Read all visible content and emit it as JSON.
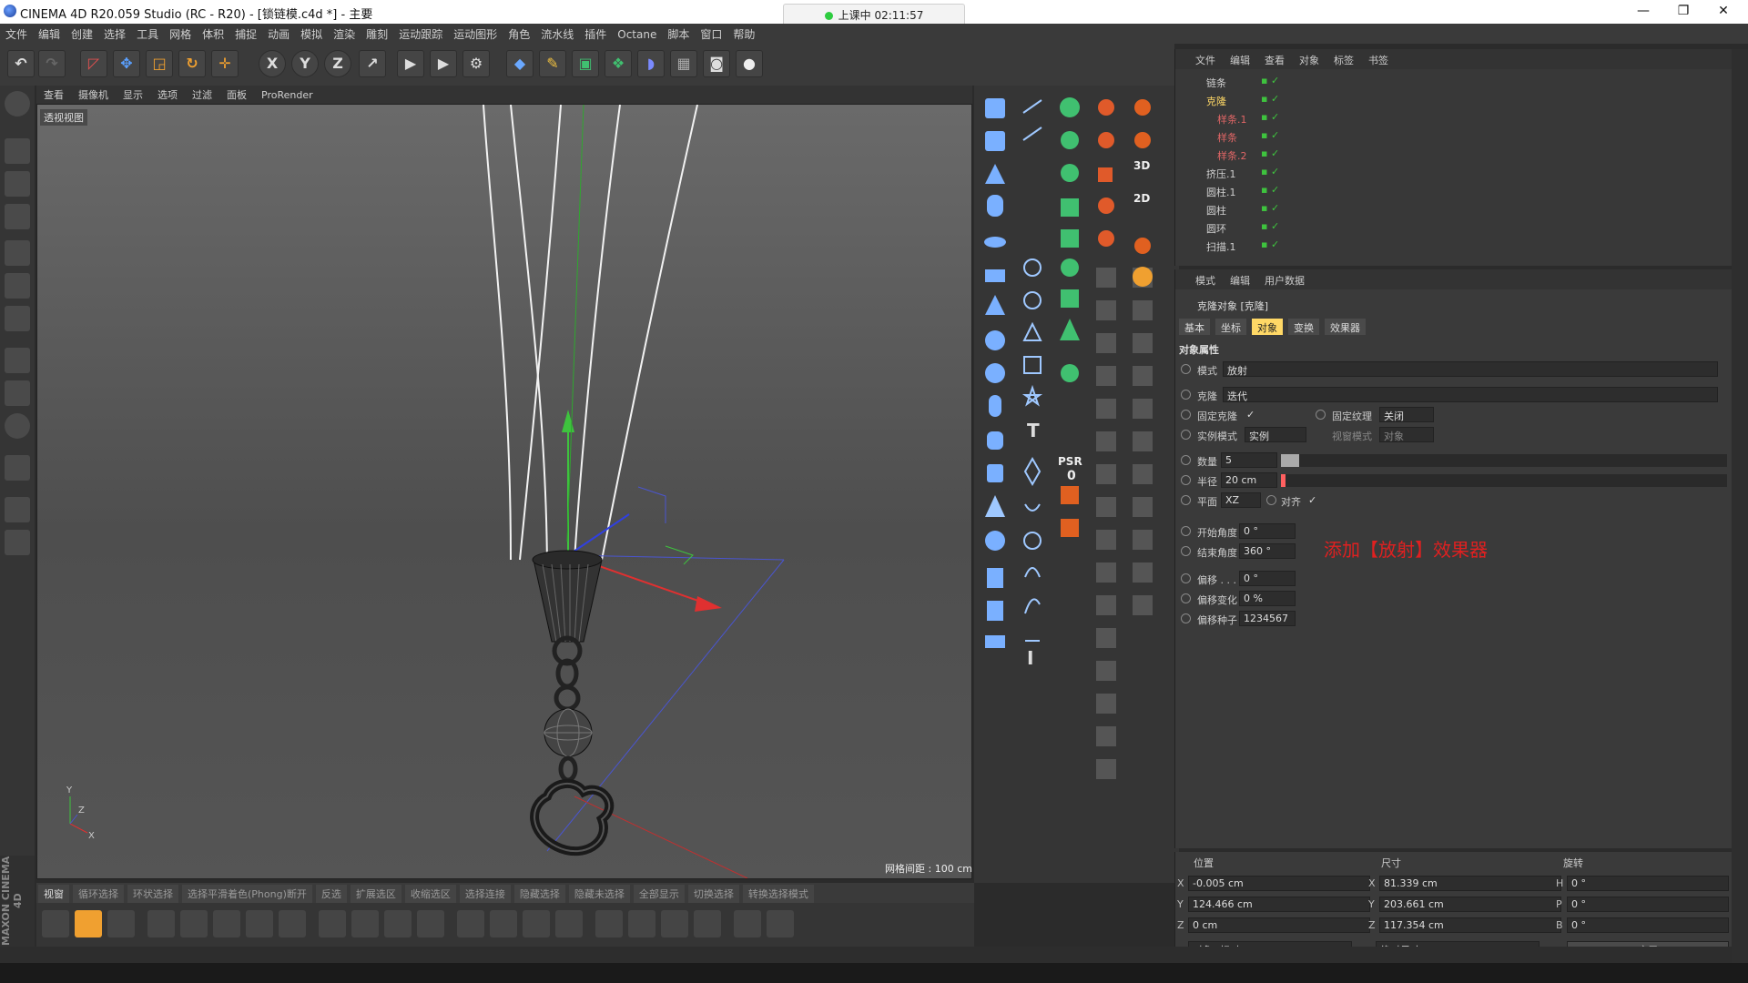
{
  "window": {
    "title": "CINEMA 4D R20.059 Studio (RC - R20) - [锁链模.c4d *] - 主要",
    "recording": "上课中 02:11:57",
    "min_label": "—",
    "restore_label": "❐",
    "close_label": "✕"
  },
  "menu": [
    "文件",
    "编辑",
    "创建",
    "选择",
    "工具",
    "网格",
    "体积",
    "捕捉",
    "动画",
    "模拟",
    "渲染",
    "雕刻",
    "运动跟踪",
    "运动图形",
    "角色",
    "流水线",
    "插件",
    "Octane",
    "脚本",
    "窗口",
    "帮助"
  ],
  "toolbar": {
    "undo": "↶",
    "redo": "↷",
    "axis_x": "X",
    "axis_y": "Y",
    "axis_z": "Z"
  },
  "viewport": {
    "tabs": [
      "查看",
      "摄像机",
      "显示",
      "选项",
      "过滤",
      "面板",
      "ProRender"
    ],
    "label": "透视视图",
    "grid_spacing": "网格间距 : 100 cm",
    "axis_y": "Y",
    "axis_x": "X",
    "axis_z": "Z"
  },
  "object_manager": {
    "menu": [
      "文件",
      "编辑",
      "查看",
      "对象",
      "标签",
      "书签"
    ],
    "objects": [
      {
        "name": "链条",
        "color": "#cfcfcf"
      },
      {
        "name": "克隆",
        "color": "#ffd866"
      },
      {
        "name": "样条.1",
        "color": "#e06666"
      },
      {
        "name": "样条",
        "color": "#e06666"
      },
      {
        "name": "样条.2",
        "color": "#e06666"
      },
      {
        "name": "挤压.1",
        "color": "#cfcfcf"
      },
      {
        "name": "圆柱.1",
        "color": "#cfcfcf"
      },
      {
        "name": "圆柱",
        "color": "#cfcfcf"
      },
      {
        "name": "圆环",
        "color": "#cfcfcf"
      },
      {
        "name": "扫描.1",
        "color": "#cfcfcf"
      }
    ],
    "check_glyphs": "▪ ✓"
  },
  "attributes": {
    "menu": [
      "模式",
      "编辑",
      "用户数据"
    ],
    "object_title": "克隆对象 [克隆]",
    "tabs": [
      "基本",
      "坐标",
      "对象",
      "变换",
      "效果器"
    ],
    "active_tab": "对象",
    "section": "对象属性",
    "mode_label": "模式",
    "mode_value": "放射",
    "clone_label": "克隆",
    "clone_value": "迭代",
    "fix_clone_label": "固定克隆",
    "fix_clone_check": "✓",
    "fix_texture_label": "固定纹理",
    "fix_texture_value": "关闭",
    "instance_mode_label": "实例模式",
    "instance_mode_value": "实例",
    "viewport_mode_label": "视窗模式",
    "viewport_mode_value": "对象",
    "count_label": "数量",
    "count_value": "5",
    "count_fraction": 0.04,
    "radius_label": "半径",
    "radius_value": "20 cm",
    "radius_fraction": 0.01,
    "plane_label": "平面",
    "plane_value": "XZ",
    "align_label": "对齐",
    "align_check": "✓",
    "start_angle_label": "开始角度",
    "start_angle_value": "0 °",
    "end_angle_label": "结束角度",
    "end_angle_value": "360 °",
    "offset_label": "偏移 . . . . .",
    "offset_value": "0 °",
    "offset_var_label": "偏移变化",
    "offset_var_value": "0 %",
    "offset_seed_label": "偏移种子",
    "offset_seed_value": "1234567"
  },
  "annotation": "添加【放射】效果器",
  "coordinates": {
    "headers": [
      "位置",
      "尺寸",
      "旋转"
    ],
    "pos": {
      "x": "-0.005 cm",
      "y": "124.466 cm",
      "z": "0 cm"
    },
    "size": {
      "x": "81.339 cm",
      "y": "203.661 cm",
      "z": "117.354 cm"
    },
    "rot": {
      "h": "0 °",
      "p": "0 °",
      "b": "0 °"
    },
    "axis_labels": {
      "x": "X",
      "y": "Y",
      "z": "Z",
      "h": "H",
      "p": "P",
      "b": "B"
    },
    "mode_left": "对象 (相对)",
    "mode_right": "绝对尺寸",
    "apply": "应用"
  },
  "bottom_bar": [
    "视窗",
    "循环选择",
    "环状选择",
    "选择平滑着色(Phong)断开",
    "反选",
    "扩展选区",
    "收缩选区",
    "选择连接",
    "隐藏选择",
    "隐藏未选择",
    "全部显示",
    "切换选择",
    "转换选择模式"
  ],
  "side_labels": {
    "maxon": "MAXON CINEMA 4D",
    "psr": "PSR",
    "psr_value": "0",
    "label_3d": "3D",
    "label_2d": "2D"
  },
  "colors": {
    "accent_yellow": "#ffd866",
    "annotation_red": "#e02020",
    "check_green": "#3ec33e"
  }
}
